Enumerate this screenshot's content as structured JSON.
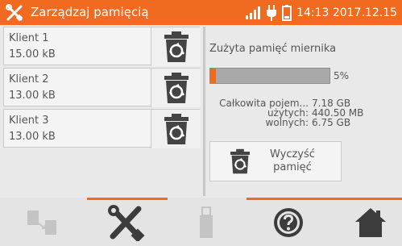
{
  "header": {
    "title": "Zarządzaj pamięcią",
    "clock": "14:13 2017.12.15",
    "icons": [
      "tools-icon",
      "signal-icon",
      "power-plug-icon",
      "battery-icon"
    ],
    "background_color": "#f06a1f"
  },
  "clients": [
    {
      "name": "Klient 1",
      "size": "15.00 kB"
    },
    {
      "name": "Klient 2",
      "size": "13.00 kB"
    },
    {
      "name": "Klient 3",
      "size": "13.00 kB"
    }
  ],
  "memory": {
    "title": "Zużyta pamięć miernika",
    "used_fraction": 0.05,
    "used_percent_label": "5%",
    "total_label": "Całkowita pojem...",
    "total_value": "7.18 GB",
    "used_label": "użytych:",
    "used_value": "440.50 MB",
    "free_label": "wolnych:",
    "free_value": "6.75 GB",
    "clear_button_line1": "Wyczyść",
    "clear_button_line2": "pamięć"
  },
  "toolbar": {
    "buttons": [
      {
        "icon": "transfer-icon",
        "enabled": false
      },
      {
        "icon": "tools-icon",
        "enabled": true
      },
      {
        "icon": "usb-icon",
        "enabled": false
      },
      {
        "icon": "help-icon",
        "enabled": true
      },
      {
        "icon": "home-icon",
        "enabled": true
      }
    ]
  },
  "accent_color": "#f06a1f"
}
